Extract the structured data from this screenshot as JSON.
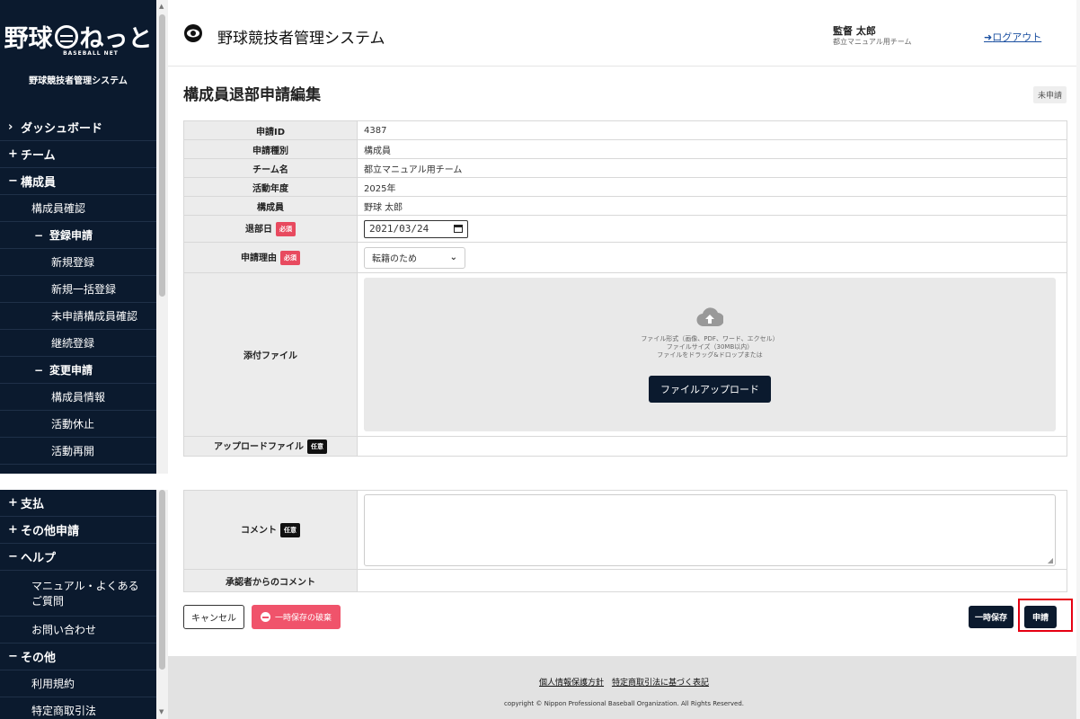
{
  "brand": {
    "logo_left": "野球",
    "logo_right": "ねっと",
    "logo_sub": "BASEBALL NET",
    "system_name": "野球競技者管理システム"
  },
  "sidebar": {
    "items": [
      {
        "prefix": "›",
        "label": "ダッシュボード"
      },
      {
        "prefix": "+",
        "label": "チーム"
      },
      {
        "prefix": "−",
        "label": "構成員"
      }
    ],
    "member_confirm": "構成員確認",
    "register": {
      "prefix": "−",
      "label": "登録申請"
    },
    "register_items": [
      "新規登録",
      "新規一括登録",
      "未申請構成員確認",
      "継続登録"
    ],
    "change": {
      "prefix": "−",
      "label": "変更申請"
    },
    "change_items": [
      "構成員情報",
      "活動休止",
      "活動再開"
    ],
    "bottom_items": [
      {
        "prefix": "+",
        "label": "支払"
      },
      {
        "prefix": "+",
        "label": "その他申請"
      },
      {
        "prefix": "−",
        "label": "ヘルプ"
      }
    ],
    "help_items": [
      "マニュアル・よくある\nご質問",
      "お問い合わせ"
    ],
    "other": {
      "prefix": "−",
      "label": "その他"
    },
    "other_items": [
      "利用規約",
      "特定商取引法"
    ]
  },
  "header": {
    "title": "野球競技者管理システム",
    "user_name": "監督 太郎",
    "user_team": "都立マニュアル用チーム",
    "logout": "ログアウト"
  },
  "page": {
    "title": "構成員退部申請編集",
    "status": "未申請"
  },
  "form": {
    "required_badge": "必須",
    "optional_badge": "任意",
    "rows": [
      {
        "label": "申請ID",
        "value": "4387"
      },
      {
        "label": "申請種別",
        "value": "構成員"
      },
      {
        "label": "チーム名",
        "value": "都立マニュアル用チーム"
      },
      {
        "label": "活動年度",
        "value": "2025年"
      },
      {
        "label": "構成員",
        "value": "野球 太郎"
      }
    ],
    "leave_date_label": "退部日",
    "leave_date_value": "2021/03/24",
    "reason_label": "申請理由",
    "reason_value": "転籍のため",
    "attach_label": "添付ファイル",
    "dropzone_line1": "ファイル形式（画像、PDF、ワード、エクセル）",
    "dropzone_line2": "ファイルサイズ（30MB以内）",
    "dropzone_line3": "ファイルをドラッグ&ドロップまたは",
    "upload_button": "ファイルアップロード",
    "uploaded_label": "アップロードファイル",
    "comment_label": "コメント",
    "approver_comment_label": "承認者からのコメント"
  },
  "actions": {
    "cancel": "キャンセル",
    "discard": "一時保存の破棄",
    "save_temp": "一時保存",
    "apply": "申請"
  },
  "footer": {
    "privacy": "個人情報保護方針",
    "tokutei": "特定商取引法に基づく表記",
    "copyright": "copyright © Nippon Professional Baseball Organization. All Rights Reserved."
  },
  "colors": {
    "navy": "#0b1a2e",
    "required_red": "#e84a5f",
    "highlight_red": "#e60012"
  }
}
